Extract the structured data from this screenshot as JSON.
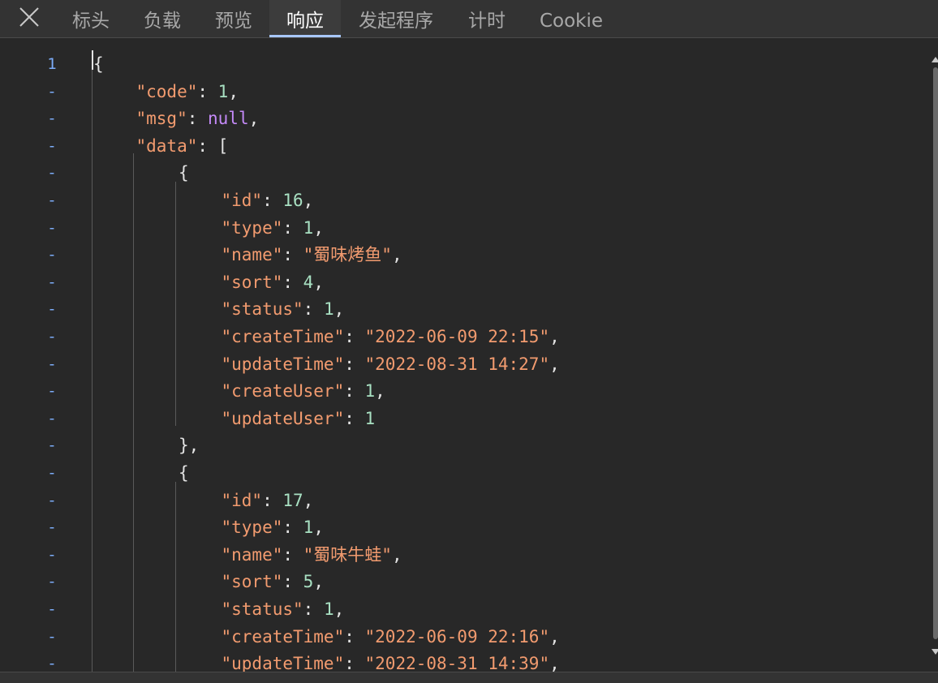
{
  "tabs": [
    {
      "label": "标头",
      "active": false
    },
    {
      "label": "负载",
      "active": false
    },
    {
      "label": "预览",
      "active": false
    },
    {
      "label": "响应",
      "active": true
    },
    {
      "label": "发起程序",
      "active": false
    },
    {
      "label": "计时",
      "active": false
    },
    {
      "label": "Cookie",
      "active": false
    }
  ],
  "gutter": {
    "first": "1",
    "fold": "-"
  },
  "lines": [
    [
      [
        "p",
        "{"
      ]
    ],
    [
      [
        "k",
        "\"code\""
      ],
      [
        "p",
        ": "
      ],
      [
        "n",
        "1"
      ],
      [
        "p",
        ","
      ]
    ],
    [
      [
        "k",
        "\"msg\""
      ],
      [
        "p",
        ": "
      ],
      [
        "z",
        "null"
      ],
      [
        "p",
        ","
      ]
    ],
    [
      [
        "k",
        "\"data\""
      ],
      [
        "p",
        ": ["
      ]
    ],
    [
      [
        "p",
        "{"
      ]
    ],
    [
      [
        "k",
        "\"id\""
      ],
      [
        "p",
        ": "
      ],
      [
        "n",
        "16"
      ],
      [
        "p",
        ","
      ]
    ],
    [
      [
        "k",
        "\"type\""
      ],
      [
        "p",
        ": "
      ],
      [
        "n",
        "1"
      ],
      [
        "p",
        ","
      ]
    ],
    [
      [
        "k",
        "\"name\""
      ],
      [
        "p",
        ": "
      ],
      [
        "s",
        "\"蜀味烤鱼\""
      ],
      [
        "p",
        ","
      ]
    ],
    [
      [
        "k",
        "\"sort\""
      ],
      [
        "p",
        ": "
      ],
      [
        "n",
        "4"
      ],
      [
        "p",
        ","
      ]
    ],
    [
      [
        "k",
        "\"status\""
      ],
      [
        "p",
        ": "
      ],
      [
        "n",
        "1"
      ],
      [
        "p",
        ","
      ]
    ],
    [
      [
        "k",
        "\"createTime\""
      ],
      [
        "p",
        ": "
      ],
      [
        "s",
        "\"2022-06-09 22:15\""
      ],
      [
        "p",
        ","
      ]
    ],
    [
      [
        "k",
        "\"updateTime\""
      ],
      [
        "p",
        ": "
      ],
      [
        "s",
        "\"2022-08-31 14:27\""
      ],
      [
        "p",
        ","
      ]
    ],
    [
      [
        "k",
        "\"createUser\""
      ],
      [
        "p",
        ": "
      ],
      [
        "n",
        "1"
      ],
      [
        "p",
        ","
      ]
    ],
    [
      [
        "k",
        "\"updateUser\""
      ],
      [
        "p",
        ": "
      ],
      [
        "n",
        "1"
      ]
    ],
    [
      [
        "p",
        "},"
      ]
    ],
    [
      [
        "p",
        "{"
      ]
    ],
    [
      [
        "k",
        "\"id\""
      ],
      [
        "p",
        ": "
      ],
      [
        "n",
        "17"
      ],
      [
        "p",
        ","
      ]
    ],
    [
      [
        "k",
        "\"type\""
      ],
      [
        "p",
        ": "
      ],
      [
        "n",
        "1"
      ],
      [
        "p",
        ","
      ]
    ],
    [
      [
        "k",
        "\"name\""
      ],
      [
        "p",
        ": "
      ],
      [
        "s",
        "\"蜀味牛蛙\""
      ],
      [
        "p",
        ","
      ]
    ],
    [
      [
        "k",
        "\"sort\""
      ],
      [
        "p",
        ": "
      ],
      [
        "n",
        "5"
      ],
      [
        "p",
        ","
      ]
    ],
    [
      [
        "k",
        "\"status\""
      ],
      [
        "p",
        ": "
      ],
      [
        "n",
        "1"
      ],
      [
        "p",
        ","
      ]
    ],
    [
      [
        "k",
        "\"createTime\""
      ],
      [
        "p",
        ": "
      ],
      [
        "s",
        "\"2022-06-09 22:16\""
      ],
      [
        "p",
        ","
      ]
    ],
    [
      [
        "k",
        "\"updateTime\""
      ],
      [
        "p",
        ": "
      ],
      [
        "s",
        "\"2022-08-31 14:39\""
      ],
      [
        "p",
        ","
      ]
    ]
  ],
  "colors": {
    "background": "#282828",
    "key": "#f29b6f",
    "string": "#f29b6f",
    "number": "#a8e0c2",
    "null": "#c58af9",
    "punctuation": "#e3e3e3",
    "line_number": "#7cacf8",
    "active_tab_underline": "#a8c7fa"
  },
  "icons": {
    "close": "close-icon"
  }
}
